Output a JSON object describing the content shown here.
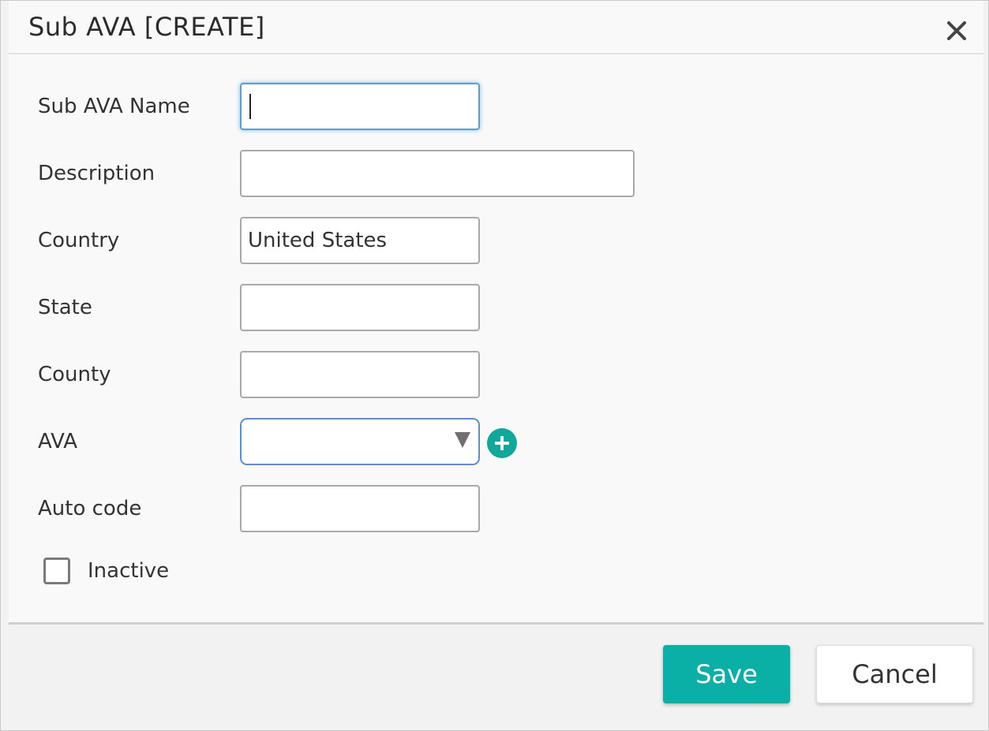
{
  "dialog": {
    "title": "Sub AVA [CREATE]",
    "close_icon": "close-icon"
  },
  "form": {
    "sub_ava_name": {
      "label": "Sub AVA Name",
      "value": ""
    },
    "description": {
      "label": "Description",
      "value": ""
    },
    "country": {
      "label": "Country",
      "value": "United States"
    },
    "state": {
      "label": "State",
      "value": ""
    },
    "county": {
      "label": "County",
      "value": ""
    },
    "ava": {
      "label": "AVA",
      "value": "",
      "add_icon": "plus-circle-icon"
    },
    "auto_code": {
      "label": "Auto code",
      "value": ""
    },
    "inactive": {
      "label": "Inactive",
      "checked": false
    }
  },
  "footer": {
    "save_label": "Save",
    "cancel_label": "Cancel"
  },
  "colors": {
    "accent": "#0ab0a6",
    "focus_border": "#5a9fd6"
  }
}
